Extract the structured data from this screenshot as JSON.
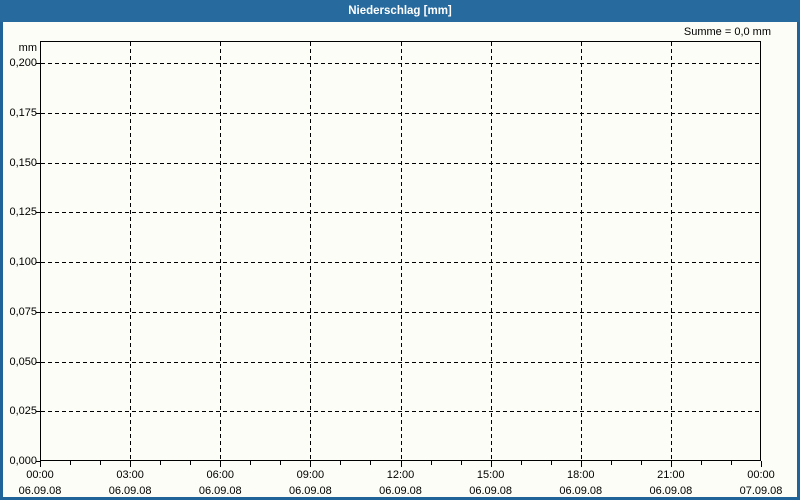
{
  "window": {
    "title": "Niederschlag [mm]"
  },
  "colors": {
    "window_border": "#1f6398",
    "titlebar": "#266a9e",
    "title_text": "#ffffff",
    "background": "#fdfdf7",
    "grid": "#000000",
    "axis_text": "#000000"
  },
  "chart_data": {
    "type": "bar",
    "title": "Niederschlag [mm]",
    "ylabel": "mm",
    "summary": "Summe = 0,0 mm",
    "sum_value_mm": 0.0,
    "grid": "dashed",
    "legend": "none",
    "ylim": [
      0.0,
      0.211
    ],
    "y_ticks": [
      {
        "label": "0,200",
        "value": 0.2
      },
      {
        "label": "0,175",
        "value": 0.175
      },
      {
        "label": "0,150",
        "value": 0.15
      },
      {
        "label": "0,125",
        "value": 0.125
      },
      {
        "label": "0,100",
        "value": 0.1
      },
      {
        "label": "0,075",
        "value": 0.075
      },
      {
        "label": "0,050",
        "value": 0.05
      },
      {
        "label": "0,025",
        "value": 0.025
      },
      {
        "label": "0,000",
        "value": 0.0
      }
    ],
    "x_range_hours": [
      0,
      24
    ],
    "x_major_step_hours": 3,
    "x_minor_step_hours": 1,
    "x_ticks": [
      {
        "hour": 0,
        "time": "00:00",
        "date": "06.09.08"
      },
      {
        "hour": 3,
        "time": "03:00",
        "date": "06.09.08"
      },
      {
        "hour": 6,
        "time": "06:00",
        "date": "06.09.08"
      },
      {
        "hour": 9,
        "time": "09:00",
        "date": "06.09.08"
      },
      {
        "hour": 12,
        "time": "12:00",
        "date": "06.09.08"
      },
      {
        "hour": 15,
        "time": "15:00",
        "date": "06.09.08"
      },
      {
        "hour": 18,
        "time": "18:00",
        "date": "06.09.08"
      },
      {
        "hour": 21,
        "time": "21:00",
        "date": "06.09.08"
      },
      {
        "hour": 24,
        "time": "00:00",
        "date": "07.09.08"
      }
    ],
    "series": [
      {
        "name": "Niederschlag",
        "values": []
      }
    ]
  }
}
